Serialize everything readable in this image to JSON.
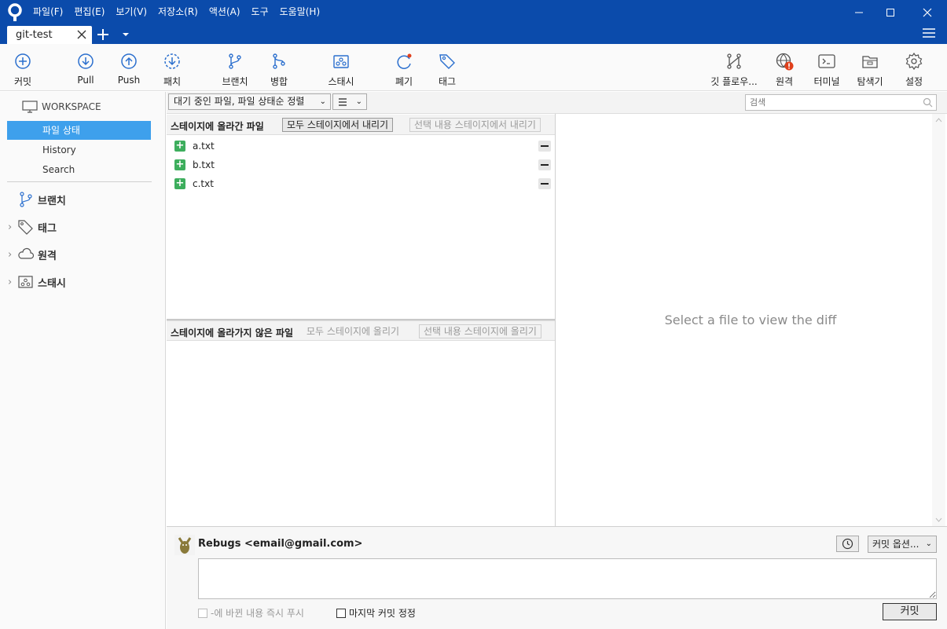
{
  "titlebar": {
    "menus": [
      "파일(F)",
      "편집(E)",
      "보기(V)",
      "저장소(R)",
      "액션(A)",
      "도구",
      "도움말(H)"
    ],
    "tab_label": "git-test"
  },
  "toolbar": {
    "commit": "커밋",
    "pull": "Pull",
    "push": "Push",
    "fetch": "패치",
    "branch": "브랜치",
    "merge": "병합",
    "stash": "스태시",
    "discard": "폐기",
    "tag": "태그",
    "gitflow": "깃 플로우...",
    "remote": "원격",
    "terminal": "터미널",
    "explorer": "탐색기",
    "settings": "설정"
  },
  "sidebar": {
    "workspace": "WORKSPACE",
    "items": [
      "파일 상태",
      "History",
      "Search"
    ],
    "groups": [
      "브랜치",
      "태그",
      "원격",
      "스태시"
    ]
  },
  "filter": {
    "sort_label": "대기 중인 파일, 파일 상태순 정렬",
    "view_icon": "list-icon",
    "search_placeholder": "검색"
  },
  "staged": {
    "title": "스테이지에 올라간 파일",
    "unstage_all": "모두 스테이지에서 내리기",
    "unstage_selected": "선택 내용 스테이지에서 내리기",
    "files": [
      "a.txt",
      "b.txt",
      "c.txt"
    ]
  },
  "unstaged": {
    "title": "스테이지에 올라가지 않은 파일",
    "stage_all": "모두 스테이지에 올리기",
    "stage_selected": "선택 내용 스테이지에 올리기"
  },
  "diff": {
    "placeholder": "Select a file to view the diff"
  },
  "commit": {
    "author": "Rebugs <email@gmail.com>",
    "options": "커밋 옵션...",
    "push_now": "-에 바뀐 내용 즉시 푸시",
    "amend": "마지막 커밋 정정",
    "commit_button": "커밋"
  },
  "colors": {
    "titlebar": "#0b4bab",
    "accent": "#3ea0ec",
    "added": "#3dae5d",
    "alert": "#e0401c"
  }
}
